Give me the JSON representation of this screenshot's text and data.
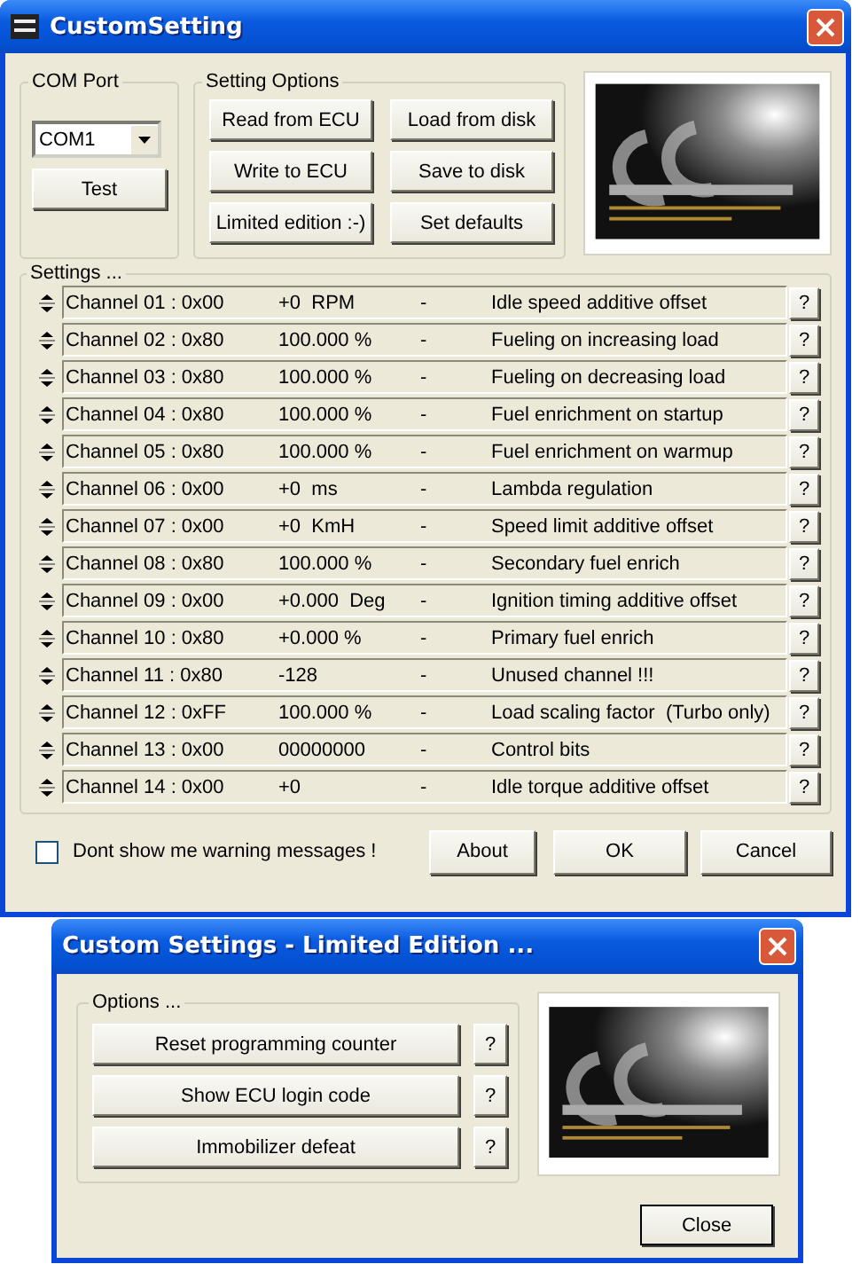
{
  "main_window": {
    "title": "CustomSetting",
    "com_port": {
      "label": "COM Port",
      "value": "COM1",
      "test_button": "Test"
    },
    "setting_options": {
      "label": "Setting Options",
      "buttons": [
        "Read from ECU",
        "Load from disk",
        "Write to ECU",
        "Save to disk",
        "Limited edition :-)",
        "Set defaults"
      ]
    },
    "settings": {
      "label": "Settings ...",
      "rows": [
        {
          "channel": "Channel 01 : 0x00",
          "value": "+0  RPM",
          "separator": "-",
          "description": "Idle speed additive offset",
          "help": "?"
        },
        {
          "channel": "Channel 02 : 0x80",
          "value": "100.000 %",
          "separator": "-",
          "description": "Fueling on increasing load",
          "help": "?"
        },
        {
          "channel": "Channel 03 : 0x80",
          "value": "100.000 %",
          "separator": "-",
          "description": "Fueling on decreasing load",
          "help": "?"
        },
        {
          "channel": "Channel 04 : 0x80",
          "value": "100.000 %",
          "separator": "-",
          "description": "Fuel enrichment on startup",
          "help": "?"
        },
        {
          "channel": "Channel 05 : 0x80",
          "value": "100.000 %",
          "separator": "-",
          "description": "Fuel enrichment on warmup",
          "help": "?"
        },
        {
          "channel": "Channel 06 : 0x00",
          "value": "+0  ms",
          "separator": "-",
          "description": "Lambda regulation",
          "help": "?"
        },
        {
          "channel": "Channel 07 : 0x00",
          "value": "+0  KmH",
          "separator": "-",
          "description": "Speed limit additive offset",
          "help": "?"
        },
        {
          "channel": "Channel 08 : 0x80",
          "value": "100.000 %",
          "separator": "-",
          "description": "Secondary fuel enrich",
          "help": "?"
        },
        {
          "channel": "Channel 09 : 0x00",
          "value": "+0.000  Deg",
          "separator": "-",
          "description": "Ignition timing additive offset",
          "help": "?"
        },
        {
          "channel": "Channel 10 : 0x80",
          "value": "+0.000 %",
          "separator": "-",
          "description": "Primary fuel enrich",
          "help": "?"
        },
        {
          "channel": "Channel 11 : 0x80",
          "value": "-128",
          "separator": "-",
          "description": "Unused channel !!!",
          "help": "?"
        },
        {
          "channel": "Channel 12 : 0xFF",
          "value": "100.000 %",
          "separator": "-",
          "description": "Load scaling factor  (Turbo only)",
          "help": "?"
        },
        {
          "channel": "Channel 13 : 0x00",
          "value": "00000000",
          "separator": "-",
          "description": "Control bits",
          "help": "?"
        },
        {
          "channel": "Channel 14 : 0x00",
          "value": "+0",
          "separator": "-",
          "description": "Idle torque additive offset",
          "help": "?"
        }
      ]
    },
    "warning_checkbox": {
      "label": "Dont show me warning messages !",
      "checked": false
    },
    "buttons": [
      "About",
      "OK",
      "Cancel"
    ]
  },
  "limited_dialog": {
    "title": "Custom Settings - Limited Edition ...",
    "options_label": "Options ...",
    "options": [
      {
        "label": "Reset programming counter",
        "help": "?"
      },
      {
        "label": "Show ECU login code",
        "help": "?"
      },
      {
        "label": "Immobilizer defeat",
        "help": "?"
      }
    ],
    "close_button": "Close"
  }
}
